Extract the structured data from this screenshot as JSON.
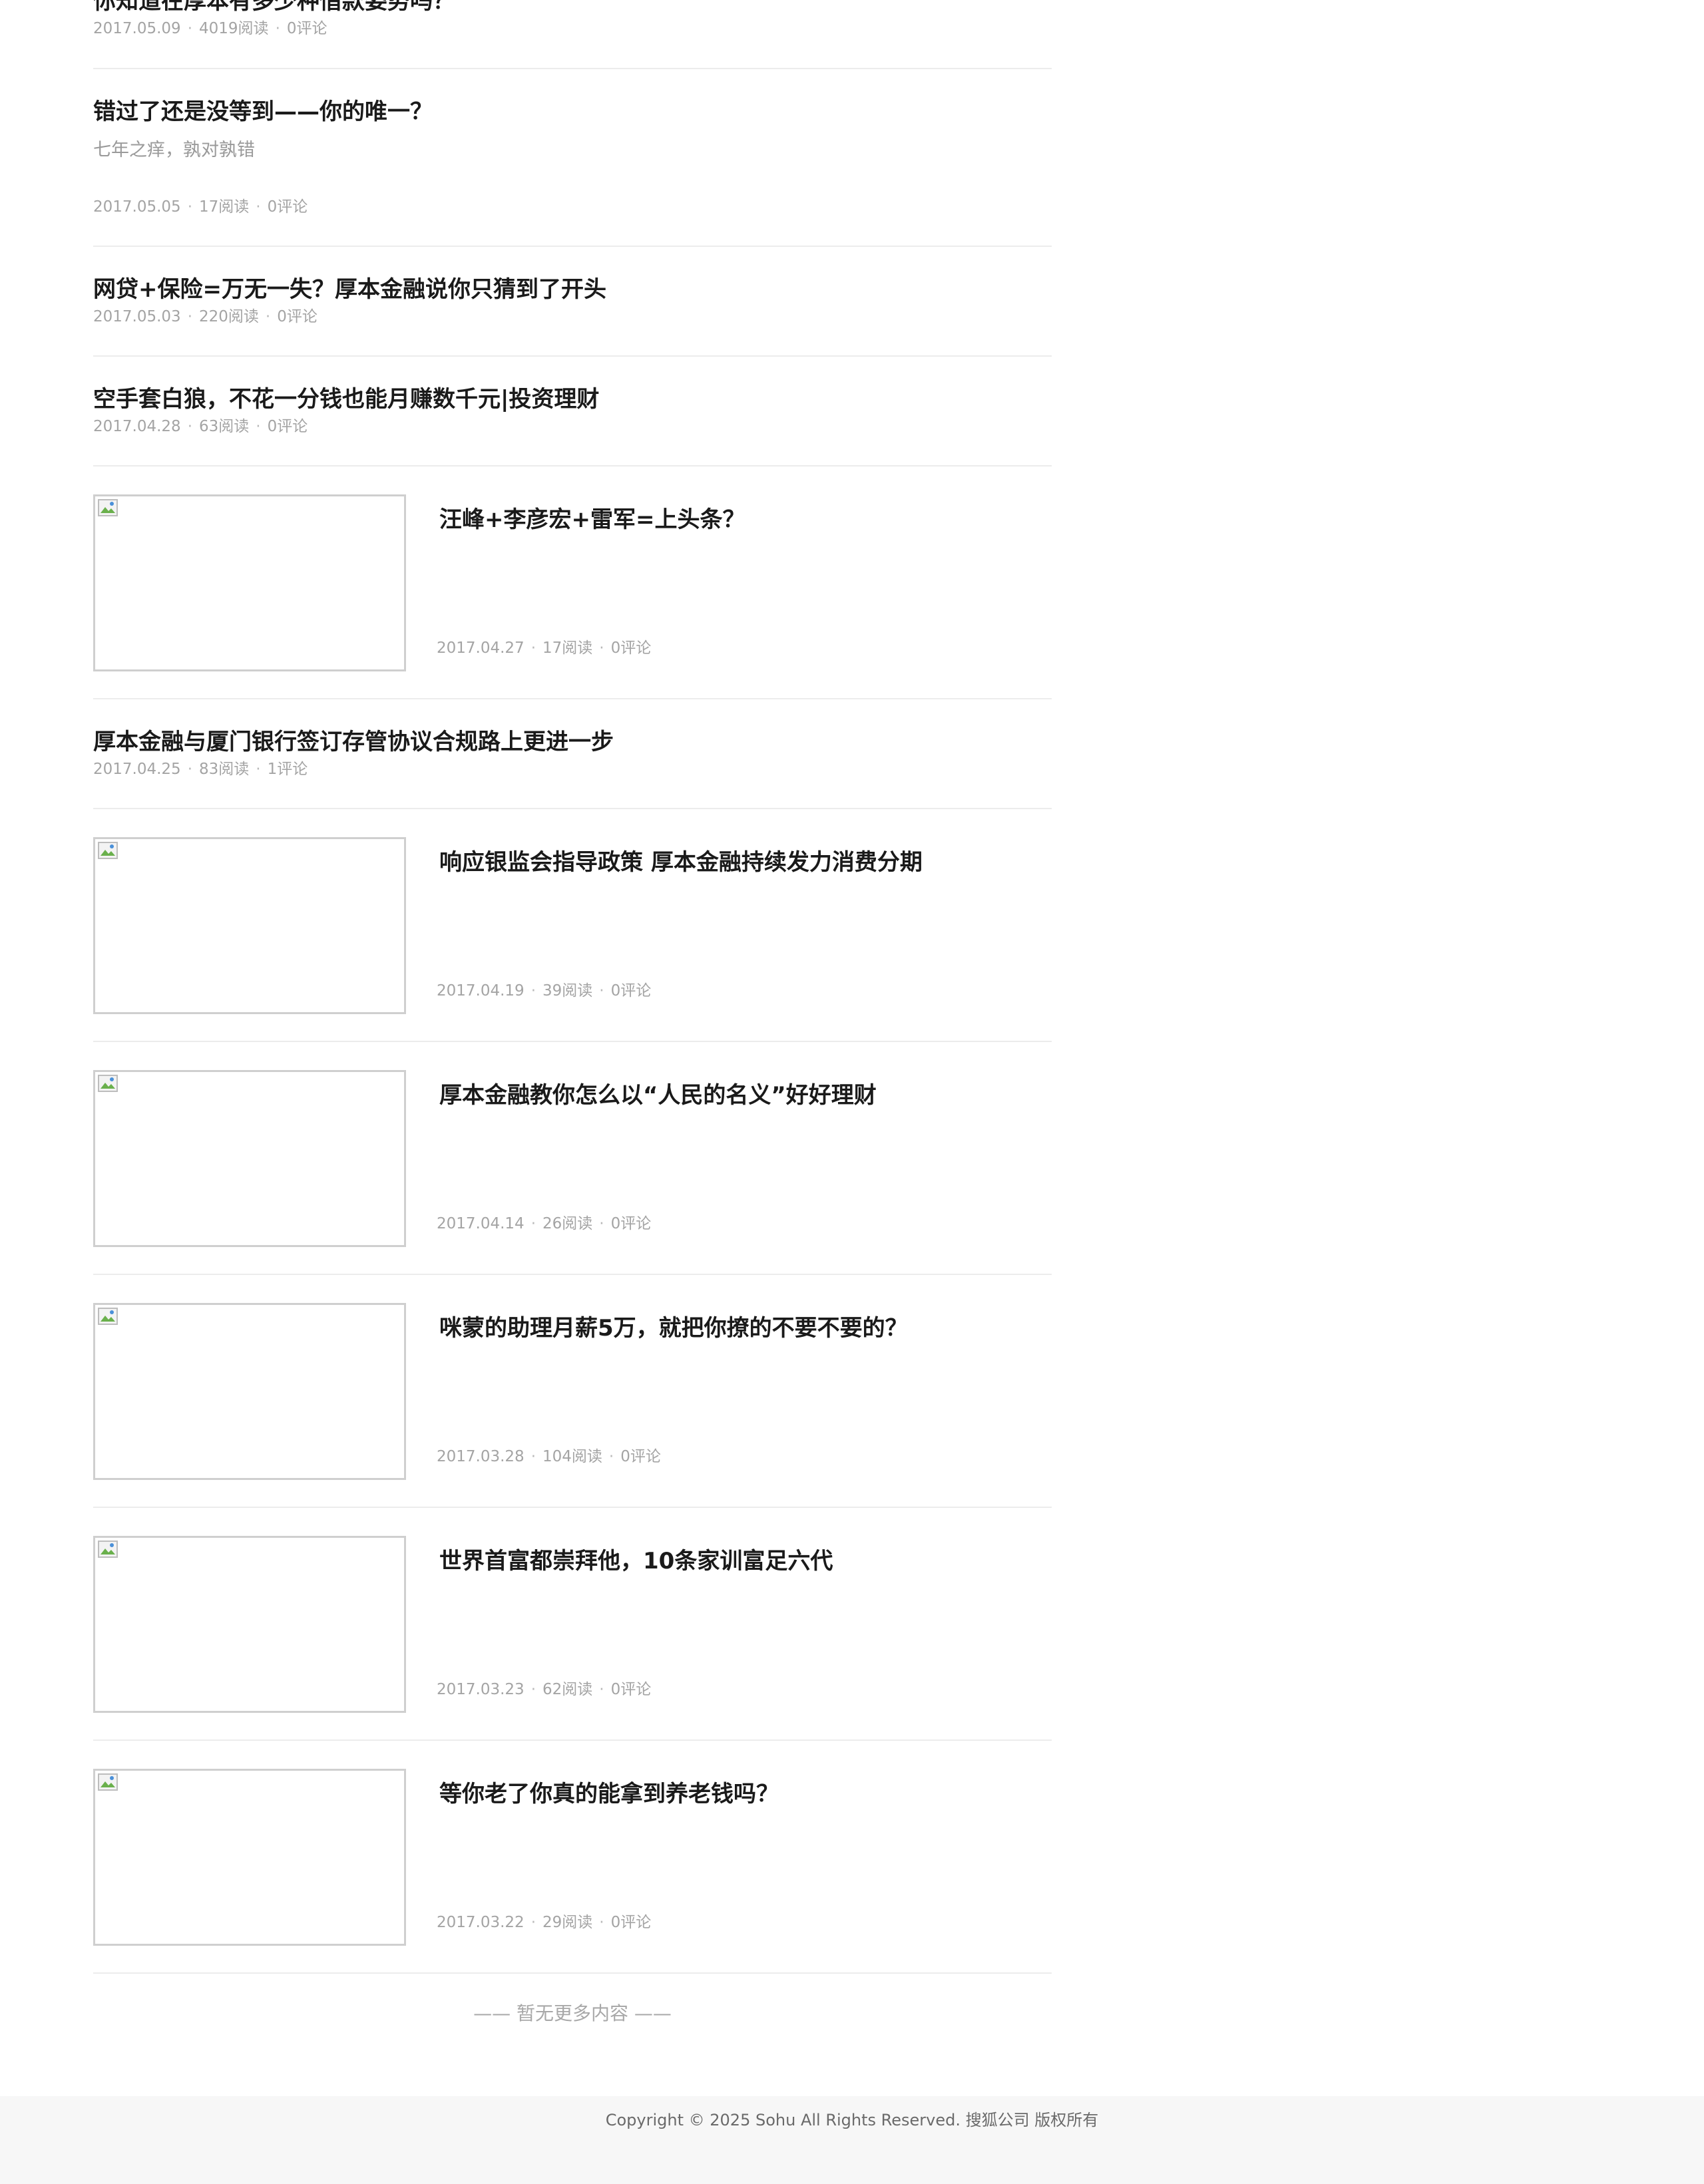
{
  "articles": [
    {
      "title": "你知道在厚本有多少种借款姿势吗？",
      "date": "2017.05.09",
      "reads": "4019阅读",
      "comments": "0评论"
    },
    {
      "title": "错过了还是没等到——你的唯一？",
      "subtitle": "七年之痒，孰对孰错",
      "date": "2017.05.05",
      "reads": "17阅读",
      "comments": "0评论"
    },
    {
      "title": "网贷+保险=万无一失？厚本金融说你只猜到了开头",
      "date": "2017.05.03",
      "reads": "220阅读",
      "comments": "0评论"
    },
    {
      "title": "空手套白狼，不花一分钱也能月赚数千元|投资理财",
      "date": "2017.04.28",
      "reads": "63阅读",
      "comments": "0评论"
    },
    {
      "title": "汪峰+李彦宏+雷军=上头条？",
      "date": "2017.04.27",
      "reads": "17阅读",
      "comments": "0评论",
      "has_image": true
    },
    {
      "title": "厚本金融与厦门银行签订存管协议合规路上更进一步",
      "date": "2017.04.25",
      "reads": "83阅读",
      "comments": "1评论"
    },
    {
      "title": "响应银监会指导政策 厚本金融持续发力消费分期",
      "date": "2017.04.19",
      "reads": "39阅读",
      "comments": "0评论",
      "has_image": true
    },
    {
      "title": "厚本金融教你怎么以“人民的名义”好好理财",
      "date": "2017.04.14",
      "reads": "26阅读",
      "comments": "0评论",
      "has_image": true
    },
    {
      "title": "咪蒙的助理月薪5万，就把你撩的不要不要的？",
      "date": "2017.03.28",
      "reads": "104阅读",
      "comments": "0评论",
      "has_image": true
    },
    {
      "title": "世界首富都崇拜他，10条家训富足六代",
      "date": "2017.03.23",
      "reads": "62阅读",
      "comments": "0评论",
      "has_image": true
    },
    {
      "title": "等你老了你真的能拿到养老钱吗？",
      "date": "2017.03.22",
      "reads": "29阅读",
      "comments": "0评论",
      "has_image": true
    }
  ],
  "meta_separator": "·",
  "end_note": "—— 暂无更多内容 ——",
  "footer": {
    "copyright": "Copyright © 2025 Sohu All Rights Reserved. 搜狐公司 版权所有"
  },
  "colors": {
    "title": "#1a1a1a",
    "meta": "#a4a4a4",
    "divider": "#ececec",
    "footer_bg": "#f7f7f7"
  },
  "icons": {
    "thumbnail": "broken-image-icon"
  }
}
